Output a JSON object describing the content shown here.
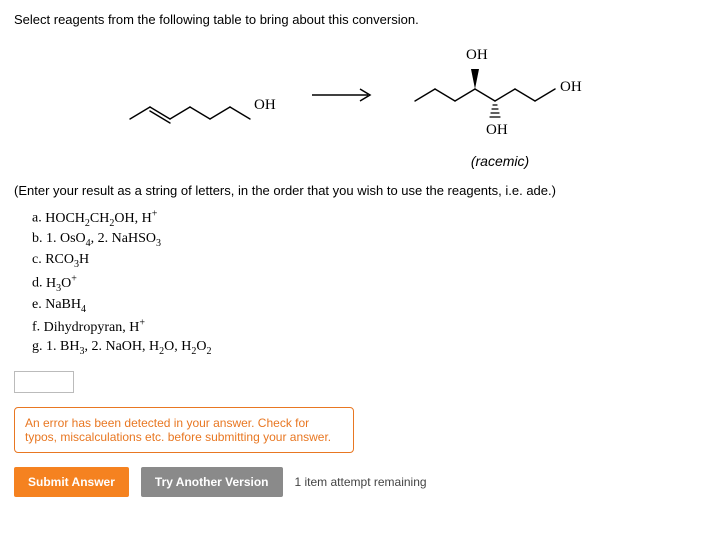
{
  "question": "Select reagents from the following table to bring about this conversion.",
  "reactant_labels": {
    "oh": "OH"
  },
  "product_labels": {
    "oh_top": "OH",
    "oh_right": "OH",
    "oh_bottom": "OH"
  },
  "racemic": "(racemic)",
  "instructions": "(Enter your result as a string of letters, in the order that you wish to use the reagents, i.e. ade.)",
  "options": {
    "a": {
      "letter": "a.",
      "html": "HOCH<sub>2</sub>CH<sub>2</sub>OH, H<sup>+</sup>"
    },
    "b": {
      "letter": "b.",
      "html": "1. OsO<sub>4</sub>, 2. NaHSO<sub>3</sub>"
    },
    "c": {
      "letter": "c.",
      "html": "RCO<sub>3</sub>H"
    },
    "d": {
      "letter": "d.",
      "html": "H<sub>3</sub>O<sup>+</sup>"
    },
    "e": {
      "letter": "e.",
      "html": "NaBH<sub>4</sub>"
    },
    "f": {
      "letter": "f.",
      "html": "Dihydropyran, H<sup>+</sup>"
    },
    "g": {
      "letter": "g.",
      "html": "1. BH<sub>3</sub>, 2. NaOH, H<sub>2</sub>O, H<sub>2</sub>O<sub>2</sub>"
    }
  },
  "answer_value": "",
  "error_message": "An error has been detected in your answer. Check for typos, miscalculations etc. before submitting your answer.",
  "buttons": {
    "submit": "Submit Answer",
    "try": "Try Another Version"
  },
  "attempts": "1 item attempt remaining"
}
